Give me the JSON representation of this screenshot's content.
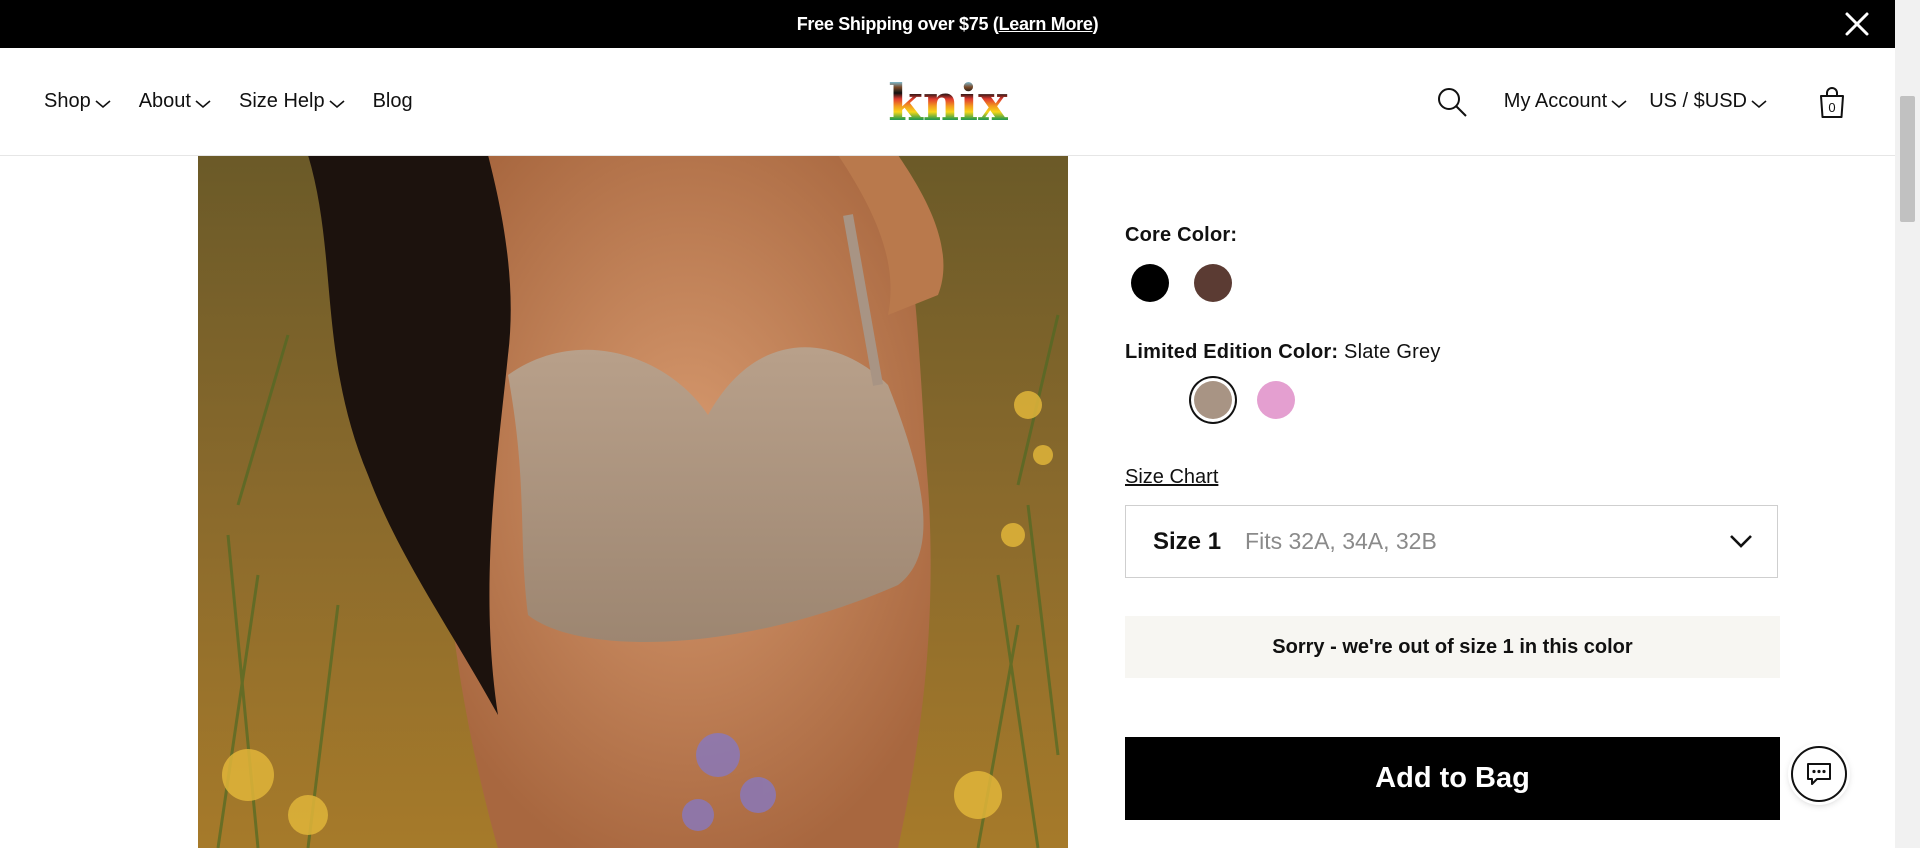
{
  "announcement": {
    "text": "Free Shipping over $75 (",
    "link": "Learn More",
    "suffix": ")"
  },
  "header": {
    "nav_left": [
      {
        "label": "Shop"
      },
      {
        "label": "About"
      },
      {
        "label": "Size Help"
      },
      {
        "label": "Blog"
      }
    ],
    "logo_text": "knix",
    "account_label": "My Account",
    "locale_label": "US / $USD",
    "bag_count": "0"
  },
  "product": {
    "core_color_label": "Core Color:",
    "core_colors": [
      {
        "name": "Black",
        "hex": "#000000"
      },
      {
        "name": "Espresso",
        "hex": "#5b3b33"
      }
    ],
    "limited_label": "Limited Edition Color:",
    "limited_selected": "Slate Grey",
    "limited_colors": [
      {
        "name": "Slate Grey",
        "hex": "#a89484"
      },
      {
        "name": "Pink",
        "hex": "#e49fd0"
      }
    ],
    "size_chart_label": "Size Chart",
    "size": {
      "name": "Size 1",
      "fit": "Fits 32A, 34A, 32B"
    },
    "out_of_stock_message": "Sorry - we're out of size 1 in this color",
    "add_to_bag_label": "Add to Bag"
  },
  "colors": {
    "announcement_bg": "#000000",
    "button_bg": "#000000",
    "notice_bg": "#f7f6f2"
  }
}
